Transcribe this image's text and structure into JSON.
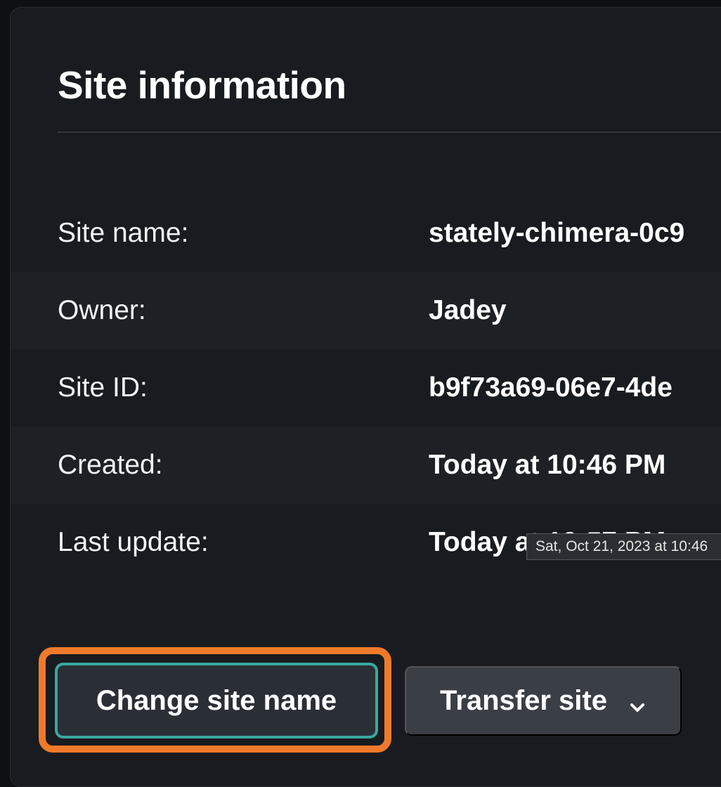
{
  "panel": {
    "title": "Site information"
  },
  "details": [
    {
      "label": "Site name:",
      "value": "stately-chimera-0c9"
    },
    {
      "label": "Owner:",
      "value": "Jadey"
    },
    {
      "label": "Site ID:",
      "value": "b9f73a69-06e7-4de"
    },
    {
      "label": "Created:",
      "value": "Today at 10:46 PM"
    },
    {
      "label": "Last update:",
      "value": "Today at 10:57 PM"
    }
  ],
  "tooltip": {
    "text": "Sat, Oct 21, 2023 at 10:46"
  },
  "actions": {
    "change_name_label": "Change site name",
    "transfer_label": "Transfer site",
    "transfer_icon": "chevron-down-icon"
  },
  "colors": {
    "background": "#181b1f",
    "focus_ring": "#f07a2b",
    "button_border": "#3aa7a0",
    "secondary_button": "#3a3f46"
  }
}
